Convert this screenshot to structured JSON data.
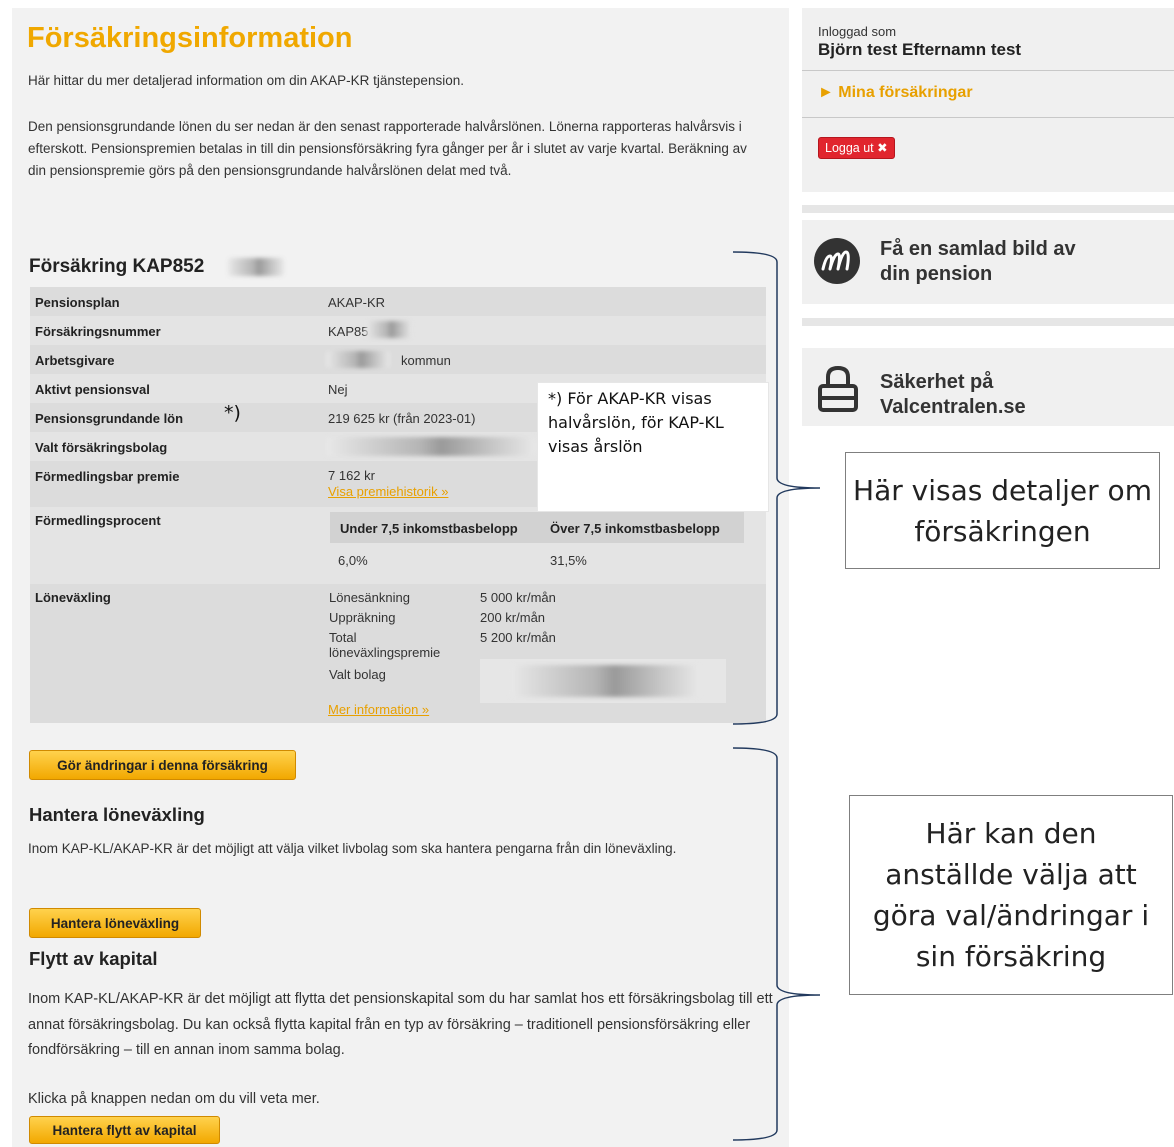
{
  "main": {
    "title": "Försäkringsinformation",
    "intro": "Här hittar du mer detaljerad information om din AKAP-KR tjänstepension.",
    "description": "Den pensionsgrundande lönen du ser nedan är den senast rapporterade halvårslönen. Lönerna rapporteras halvårsvis i efterskott. Pensionspremien betalas in till din pensionsförsäkring fyra gånger per år i slutet av varje kvartal. Beräkning av din pensionspremie görs på den pensionsgrundande halvårslönen delat med två."
  },
  "insurance": {
    "title": "Försäkring KAP852",
    "rows": {
      "plan": {
        "label": "Pensionsplan",
        "value": "AKAP-KR"
      },
      "number": {
        "label": "Försäkringsnummer",
        "value": "KAP85"
      },
      "employer": {
        "label": "Arbetsgivare",
        "value": "kommun"
      },
      "active_choice": {
        "label": "Aktivt pensionsval",
        "value": "Nej"
      },
      "salary": {
        "label": "Pensionsgrundande lön",
        "value": "219 625 kr (från 2023-01)"
      },
      "company": {
        "label": "Valt försäkringsbolag"
      },
      "premium": {
        "label": "Förmedlingsbar premie",
        "value": "7 162 kr",
        "link": "Visa premiehistorik »"
      },
      "percent": {
        "label": "Förmedlingsprocent",
        "headers": [
          "Under 7,5 inkomstbasbelopp",
          "Över 7,5 inkomstbasbelopp"
        ],
        "values": [
          "6,0%",
          "31,5%"
        ]
      },
      "salary_exchange": {
        "label": "Löneväxling",
        "items": [
          {
            "label": "Lönesänkning",
            "value": "5 000 kr/mån"
          },
          {
            "label": "Uppräkning",
            "value": "200 kr/mån"
          },
          {
            "label": "Total löneväxlingspremie",
            "value": "5 200 kr/mån"
          },
          {
            "label": "Valt bolag",
            "value": ""
          }
        ],
        "link": "Mer information »"
      }
    }
  },
  "buttons": {
    "change": "Gör ändringar i denna försäkring",
    "manage_exchange": "Hantera löneväxling",
    "transfer": "Hantera flytt av kapital"
  },
  "salary_exchange_section": {
    "title": "Hantera löneväxling",
    "text": "Inom KAP-KL/AKAP-KR är det möjligt att välja vilket livbolag som ska hantera pengarna från din löneväxling."
  },
  "transfer_section": {
    "title": "Flytt av kapital",
    "text": "Inom KAP-KL/AKAP-KR är det möjligt att flytta det pensionskapital som du har samlat hos ett försäkringsbolag till ett annat försäkringsbolag. Du kan också flytta kapital från en typ av försäkring – traditionell pensionsförsäkring eller fondförsäkring – till en annan inom samma bolag.",
    "cta": "Klicka på knappen nedan om du vill veta mer."
  },
  "sidebar": {
    "logged_in_label": "Inloggad som",
    "user_name": "Björn test Efternamn test",
    "my_insurances": "► Mina försäkringar",
    "logout": "Logga ut ✖",
    "promo_pension": "Få en samlad bild av din pension",
    "promo_security": "Säkerhet på Valcentralen.se"
  },
  "annotations": {
    "asterisk": "*)",
    "note": "*) För AKAP-KR visas halvårslön, för KAP-KL visas årslön",
    "callout_details": "Här visas detaljer om försäkringen",
    "callout_choices": "Här kan den anställde välja att göra val/ändringar i sin försäkring"
  },
  "colors": {
    "accent": "#f0a800",
    "logout": "#e1252e"
  }
}
